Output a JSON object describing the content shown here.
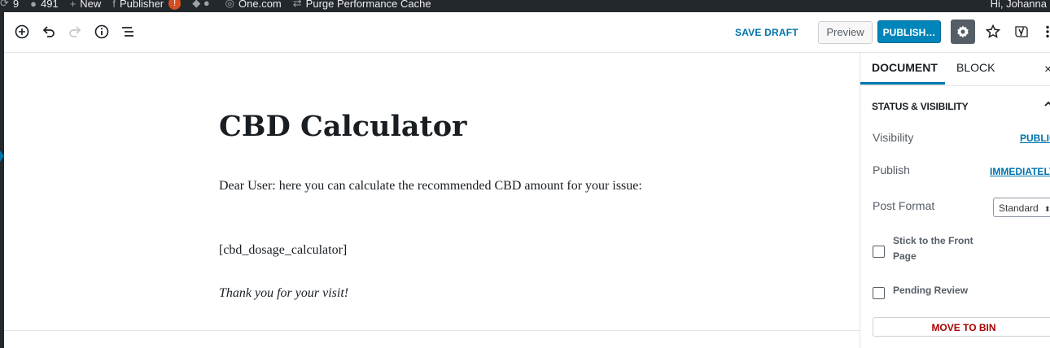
{
  "admin_bar": {
    "updates_count": "9",
    "comments_count": "491",
    "new_label": "New",
    "publisher_label": "Publisher",
    "publisher_badge": "!",
    "site_label": "One.com",
    "purge_label": "Purge Performance Cache",
    "greeting": "Hi, Johanna"
  },
  "toolbar": {
    "save_draft_label": "SAVE DRAFT",
    "preview_label": "Preview",
    "publish_label": "PUBLISH…"
  },
  "post": {
    "title": "CBD Calculator",
    "paragraph_1": "Dear User: here you can calculate the recommended CBD amount for your issue:",
    "paragraph_2": "[cbd_dosage_calculator]",
    "paragraph_3": "Thank you for your visit!"
  },
  "sidebar": {
    "tab_document": "DOCUMENT",
    "tab_block": "BLOCK",
    "close_glyph": "×",
    "status_panel_title": "STATUS & VISIBILITY",
    "visibility_label": "Visibility",
    "visibility_value": "PUBLIC",
    "publish_label": "Publish",
    "publish_value": "IMMEDIATELY",
    "format_label": "Post Format",
    "format_value": "Standard",
    "sticky_label": "Stick to the Front Page",
    "pending_label": "Pending Review",
    "move_to_bin_label": "MOVE TO BIN"
  },
  "colors": {
    "admin_bar_bg": "#23282d",
    "accent_blue": "#0073aa",
    "publish_button": "#0085ba",
    "danger_red": "#aa0000"
  }
}
